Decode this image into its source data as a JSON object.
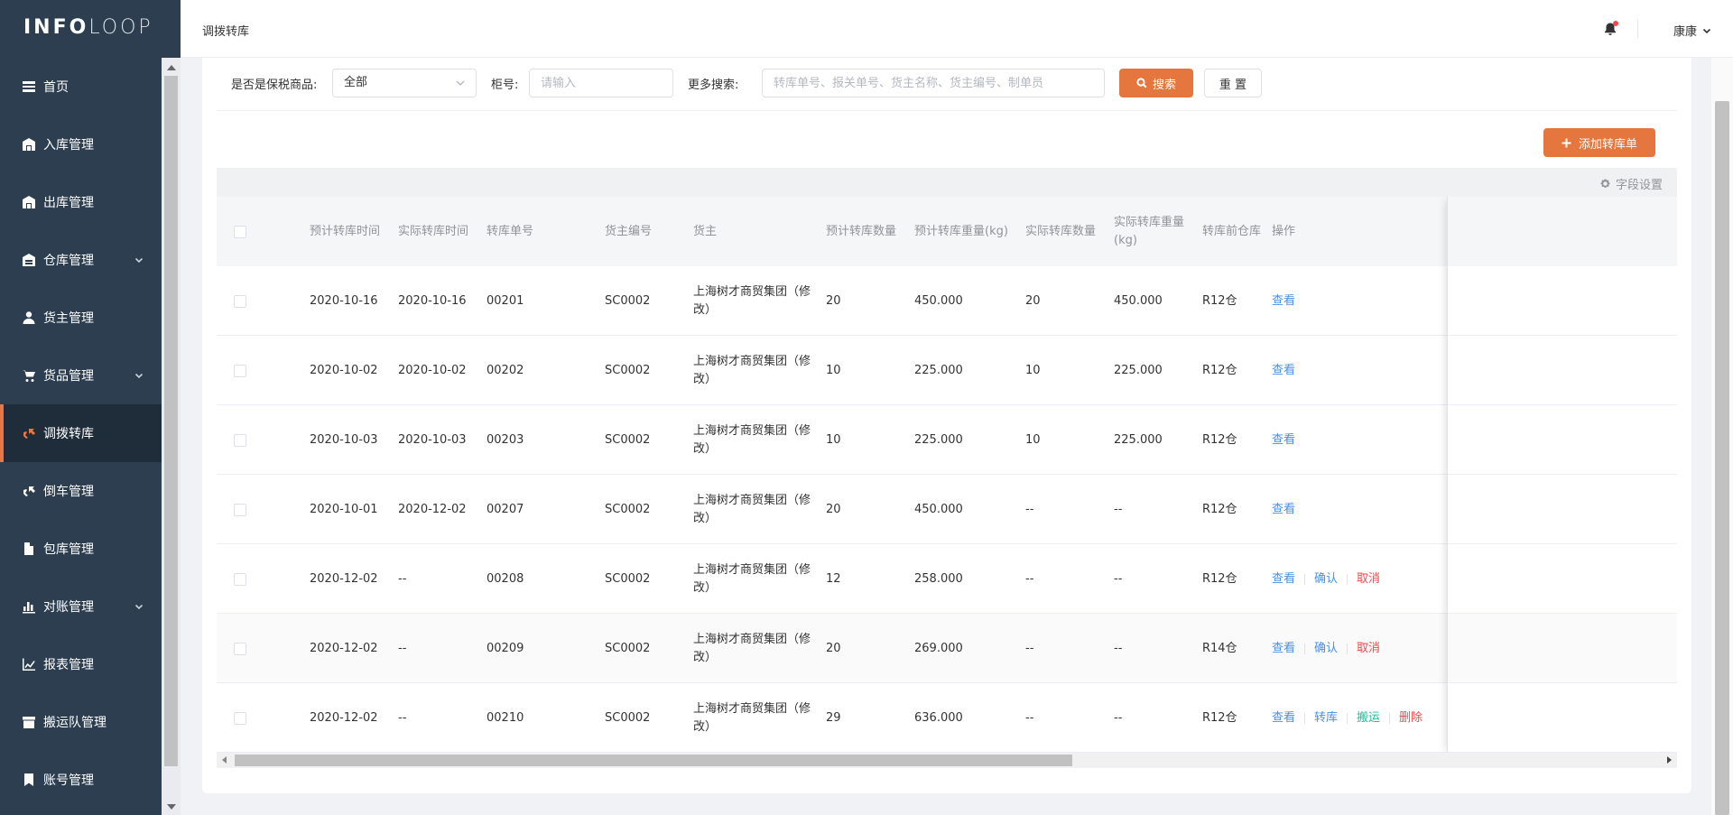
{
  "logo": {
    "bold": "INFO",
    "light": "LOOP"
  },
  "sidebar": {
    "items": [
      {
        "label": "首页",
        "icon": "dashboard-icon",
        "expand": false,
        "active": false
      },
      {
        "label": "入库管理",
        "icon": "warehouse-in-icon",
        "expand": false,
        "active": false
      },
      {
        "label": "出库管理",
        "icon": "warehouse-out-icon",
        "expand": false,
        "active": false
      },
      {
        "label": "仓库管理",
        "icon": "warehouse-icon",
        "expand": true,
        "active": false
      },
      {
        "label": "货主管理",
        "icon": "user-icon",
        "expand": false,
        "active": false
      },
      {
        "label": "货品管理",
        "icon": "cart-icon",
        "expand": true,
        "active": false
      },
      {
        "label": "调拨转库",
        "icon": "transfer-icon",
        "expand": false,
        "active": true
      },
      {
        "label": "倒车管理",
        "icon": "truck-icon",
        "expand": false,
        "active": false
      },
      {
        "label": "包库管理",
        "icon": "file-icon",
        "expand": false,
        "active": false
      },
      {
        "label": "对账管理",
        "icon": "bar-chart-icon",
        "expand": true,
        "active": false
      },
      {
        "label": "报表管理",
        "icon": "line-chart-icon",
        "expand": false,
        "active": false
      },
      {
        "label": "搬运队管理",
        "icon": "box-icon",
        "expand": false,
        "active": false
      },
      {
        "label": "账号管理",
        "icon": "bookmark-icon",
        "expand": false,
        "active": false
      }
    ]
  },
  "header": {
    "breadcrumb": "调拨转库",
    "user": "康康"
  },
  "filters": {
    "bonded_label": "是否是保税商品:",
    "bonded_value": "全部",
    "cabinet_label": "柜号:",
    "cabinet_placeholder": "请输入",
    "more_label": "更多搜索:",
    "more_placeholder": "转库单号、报关单号、货主名称、货主编号、制单员",
    "search_label": "搜索",
    "reset_label": "重 置"
  },
  "add_button": "添加转库单",
  "field_settings": "字段设置",
  "table": {
    "columns": [
      "预计转库时间",
      "实际转库时间",
      "转库单号",
      "货主编号",
      "货主",
      "预计转库数量",
      "预计转库重量(kg)",
      "实际转库数量",
      "实际转库重量(kg)",
      "转库前仓库",
      "操作"
    ],
    "rows": [
      {
        "plan_time": "2020-10-16",
        "actual_time": "2020-10-16",
        "no": "00201",
        "owner_code": "SC0002",
        "owner": "上海树才商贸集团（修改）",
        "plan_qty": "20",
        "plan_weight": "450.000",
        "actual_qty": "20",
        "actual_weight": "450.000",
        "from_wh": "R12仓",
        "ops": [
          {
            "label": "查看",
            "type": "blue"
          }
        ]
      },
      {
        "plan_time": "2020-10-02",
        "actual_time": "2020-10-02",
        "no": "00202",
        "owner_code": "SC0002",
        "owner": "上海树才商贸集团（修改）",
        "plan_qty": "10",
        "plan_weight": "225.000",
        "actual_qty": "10",
        "actual_weight": "225.000",
        "from_wh": "R12仓",
        "ops": [
          {
            "label": "查看",
            "type": "blue"
          }
        ]
      },
      {
        "plan_time": "2020-10-03",
        "actual_time": "2020-10-03",
        "no": "00203",
        "owner_code": "SC0002",
        "owner": "上海树才商贸集团（修改）",
        "plan_qty": "10",
        "plan_weight": "225.000",
        "actual_qty": "10",
        "actual_weight": "225.000",
        "from_wh": "R12仓",
        "ops": [
          {
            "label": "查看",
            "type": "blue"
          }
        ]
      },
      {
        "plan_time": "2020-10-01",
        "actual_time": "2020-12-02",
        "no": "00207",
        "owner_code": "SC0002",
        "owner": "上海树才商贸集团（修改）",
        "plan_qty": "20",
        "plan_weight": "450.000",
        "actual_qty": "--",
        "actual_weight": "--",
        "from_wh": "R12仓",
        "ops": [
          {
            "label": "查看",
            "type": "blue"
          }
        ]
      },
      {
        "plan_time": "2020-12-02",
        "actual_time": "--",
        "no": "00208",
        "owner_code": "SC0002",
        "owner": "上海树才商贸集团（修改）",
        "plan_qty": "12",
        "plan_weight": "258.000",
        "actual_qty": "--",
        "actual_weight": "--",
        "from_wh": "R12仓",
        "ops": [
          {
            "label": "查看",
            "type": "blue"
          },
          {
            "label": "确认",
            "type": "blue"
          },
          {
            "label": "取消",
            "type": "red"
          }
        ]
      },
      {
        "plan_time": "2020-12-02",
        "actual_time": "--",
        "no": "00209",
        "owner_code": "SC0002",
        "owner": "上海树才商贸集团（修改）",
        "plan_qty": "20",
        "plan_weight": "269.000",
        "actual_qty": "--",
        "actual_weight": "--",
        "from_wh": "R14仓",
        "ops": [
          {
            "label": "查看",
            "type": "blue"
          },
          {
            "label": "确认",
            "type": "blue"
          },
          {
            "label": "取消",
            "type": "red"
          }
        ]
      },
      {
        "plan_time": "2020-12-02",
        "actual_time": "--",
        "no": "00210",
        "owner_code": "SC0002",
        "owner": "上海树才商贸集团（修改）",
        "plan_qty": "29",
        "plan_weight": "636.000",
        "actual_qty": "--",
        "actual_weight": "--",
        "from_wh": "R12仓",
        "ops": [
          {
            "label": "查看",
            "type": "blue"
          },
          {
            "label": "转库",
            "type": "blue"
          },
          {
            "label": "搬运",
            "type": "green"
          },
          {
            "label": "删除",
            "type": "red"
          }
        ]
      }
    ]
  },
  "colors": {
    "sidebar_bg": "#2c3e50",
    "accent": "#e5773e",
    "link": "#4a90e2",
    "danger": "#f5484a",
    "success": "#20b89a"
  }
}
